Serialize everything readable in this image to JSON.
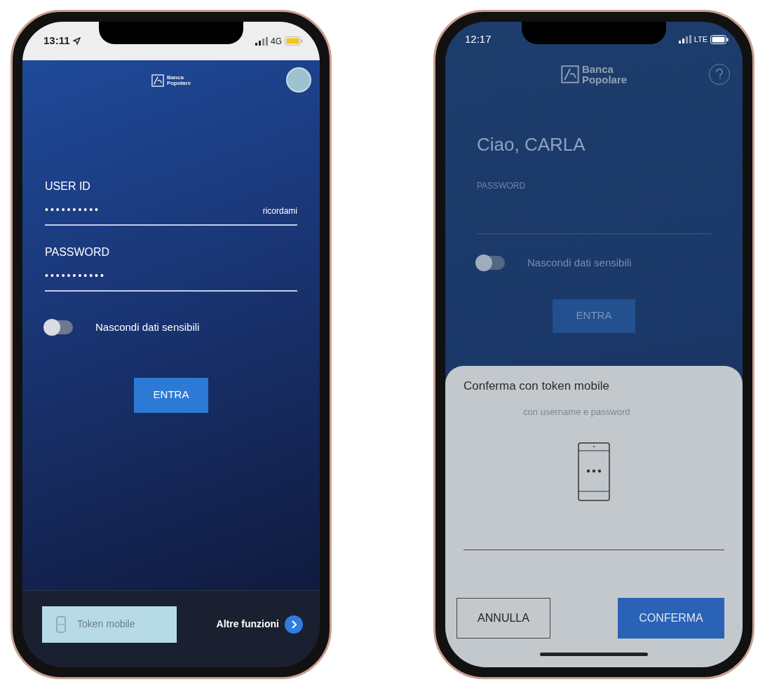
{
  "phones": [
    {
      "kind": "login",
      "status_bar": {
        "time": "13:11",
        "network": "4G"
      },
      "logo": [
        "Banca",
        "Popolare"
      ],
      "fields": [
        {
          "label": "USER ID",
          "value": "••••••••••",
          "action": "ricordami"
        },
        {
          "label": "PASSWORD",
          "value": "•••••••••••"
        }
      ],
      "toggle": {
        "label": "Nascondi dati sensibili",
        "on": false
      },
      "submit": "ENTRA",
      "bottom_bar": {
        "token_button": "Token mobile",
        "more_link": "Altre funzioni"
      }
    },
    {
      "kind": "confirm",
      "status_bar": {
        "time": "12:17",
        "network": "LTE"
      },
      "logo": [
        "Banca",
        "Popolare"
      ],
      "greeting": "Ciao, CARLA",
      "fields": [
        {
          "label": "PASSWORD"
        }
      ],
      "toggle": {
        "label": "Nascondi dati sensibili",
        "on": false
      },
      "submit": "ENTRA",
      "sheet": {
        "title": "Conferma con token mobile",
        "subtitle": "con username e password",
        "buttons": [
          {
            "label": "ANNULLA",
            "primary": false
          },
          {
            "label": "CONFERMA",
            "primary": true
          }
        ]
      }
    }
  ]
}
